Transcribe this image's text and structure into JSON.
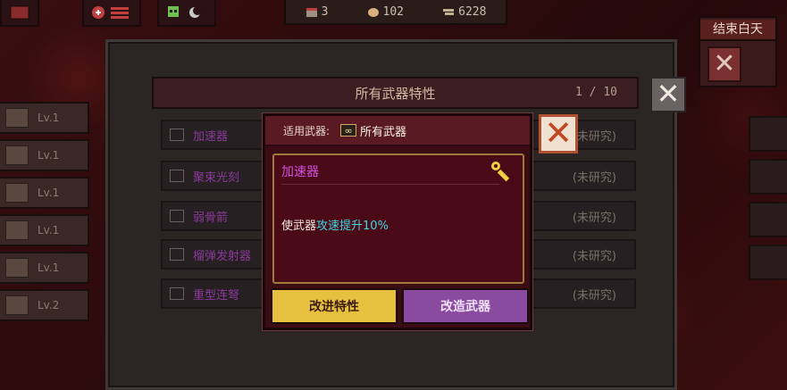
{
  "resources": {
    "day": "3",
    "food": "102",
    "money": "6228"
  },
  "end_day": {
    "label": "结束白天"
  },
  "levels": [
    "Lv.1",
    "Lv.1",
    "Lv.1",
    "Lv.1",
    "Lv.1",
    "Lv.2"
  ],
  "panel": {
    "title": "所有武器特性",
    "page": "1 / 10"
  },
  "rows": [
    {
      "name": "加速器",
      "status": "(未研究)"
    },
    {
      "name": "聚束光刻",
      "status": "(未研究)"
    },
    {
      "name": "弱骨箭",
      "status": "(未研究)"
    },
    {
      "name": "榴弹发射器",
      "status": "(未研究)"
    },
    {
      "name": "重型连弩",
      "status": "(未研究)"
    }
  ],
  "modal": {
    "applicable_label": "适用武器:",
    "applicable_value": "所有武器",
    "trait_name": "加速器",
    "desc_prefix": "使武器",
    "desc_highlight": "攻速提升",
    "desc_suffix": "10%",
    "btn_improve": "改进特性",
    "btn_modify": "改造武器"
  },
  "colors": {
    "trait_name": "#d050e0",
    "highlight": "#40d8e0",
    "improve_btn": "#e8c040",
    "modify_btn": "#8a4aa0"
  }
}
